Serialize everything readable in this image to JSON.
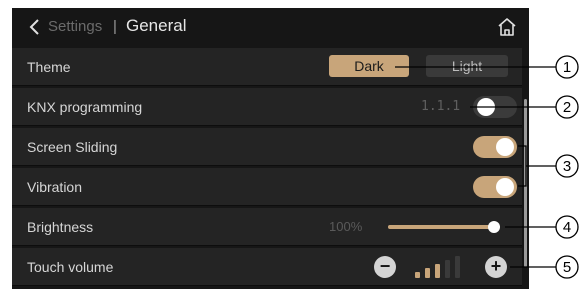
{
  "header": {
    "back_label": "Settings",
    "separator": "|",
    "title": "General",
    "icons": [
      "back-chevron-icon",
      "home-icon"
    ]
  },
  "theme": {
    "label": "Theme",
    "options": [
      "Dark",
      "Light"
    ],
    "selected": "Dark"
  },
  "knx": {
    "label": "KNX programming",
    "address": "1.1.1",
    "enabled": false
  },
  "screen_sliding": {
    "label": "Screen Sliding",
    "enabled": true
  },
  "vibration": {
    "label": "Vibration",
    "enabled": true
  },
  "brightness": {
    "label": "Brightness",
    "value_text": "100%",
    "value": 1.0
  },
  "touch_volume": {
    "label": "Touch volume",
    "minus": "−",
    "plus": "+",
    "level": 3,
    "max_level": 5
  },
  "callouts": [
    "1",
    "2",
    "3",
    "4",
    "5"
  ],
  "colors": {
    "accent": "#c8a57a",
    "background": "#161616",
    "row": "#242424",
    "inactive": "#3a3a3a",
    "text": "#d6d6d6"
  }
}
